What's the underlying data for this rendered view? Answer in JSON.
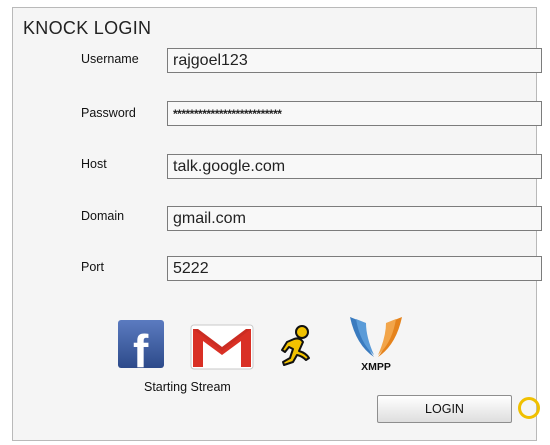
{
  "app": {
    "title": "KNOCK LOGIN"
  },
  "form": {
    "username": {
      "label": "Username",
      "value": "rajgoel123"
    },
    "password": {
      "label": "Password",
      "value": "**************************"
    },
    "host": {
      "label": "Host",
      "value": "talk.google.com"
    },
    "domain": {
      "label": "Domain",
      "value": "gmail.com"
    },
    "port": {
      "label": "Port",
      "value": "5222"
    }
  },
  "services": {
    "facebook": {
      "icon": "facebook-icon",
      "letter": "f",
      "color": "#3b5998"
    },
    "gmail": {
      "icon": "gmail-icon",
      "letter": "M",
      "color": "#d93025"
    },
    "aim": {
      "icon": "aim-running-man-icon",
      "color": "#f2c200"
    },
    "xmpp": {
      "icon": "xmpp-icon",
      "label": "XMPP",
      "colors": [
        "#3a7bbf",
        "#e5831c"
      ]
    }
  },
  "status": {
    "text": "Starting Stream"
  },
  "actions": {
    "login_label": "LOGIN"
  },
  "spinner": {
    "icon": "loading-ring-icon",
    "color": "#f0c000"
  }
}
